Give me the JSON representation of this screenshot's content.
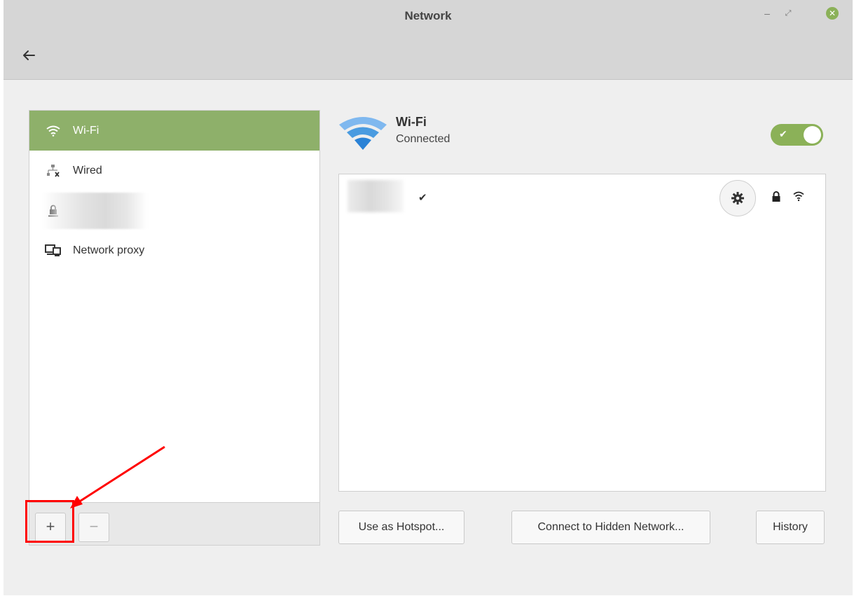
{
  "window": {
    "title": "Network"
  },
  "sidebar": {
    "items": [
      {
        "label": "Wi-Fi",
        "icon": "wifi-icon",
        "active": true
      },
      {
        "label": "Wired",
        "icon": "wired-network-icon",
        "active": false
      },
      {
        "label": "",
        "icon": "vpn-lock-icon",
        "active": false
      },
      {
        "label": "Network proxy",
        "icon": "network-proxy-icon",
        "active": false
      }
    ],
    "add_label": "+",
    "remove_label": "−"
  },
  "wifi": {
    "title": "Wi-Fi",
    "status": "Connected",
    "enabled": true
  },
  "networks": [
    {
      "name": "",
      "connected_mark": "✔",
      "secured": true,
      "signal": "strong"
    }
  ],
  "actions": {
    "hotspot": "Use as Hotspot...",
    "hidden": "Connect to Hidden Network...",
    "history": "History"
  },
  "colors": {
    "accent": "#8eb06a",
    "wifi_blue": "#4a9be0",
    "annotation": "#ff0000"
  }
}
